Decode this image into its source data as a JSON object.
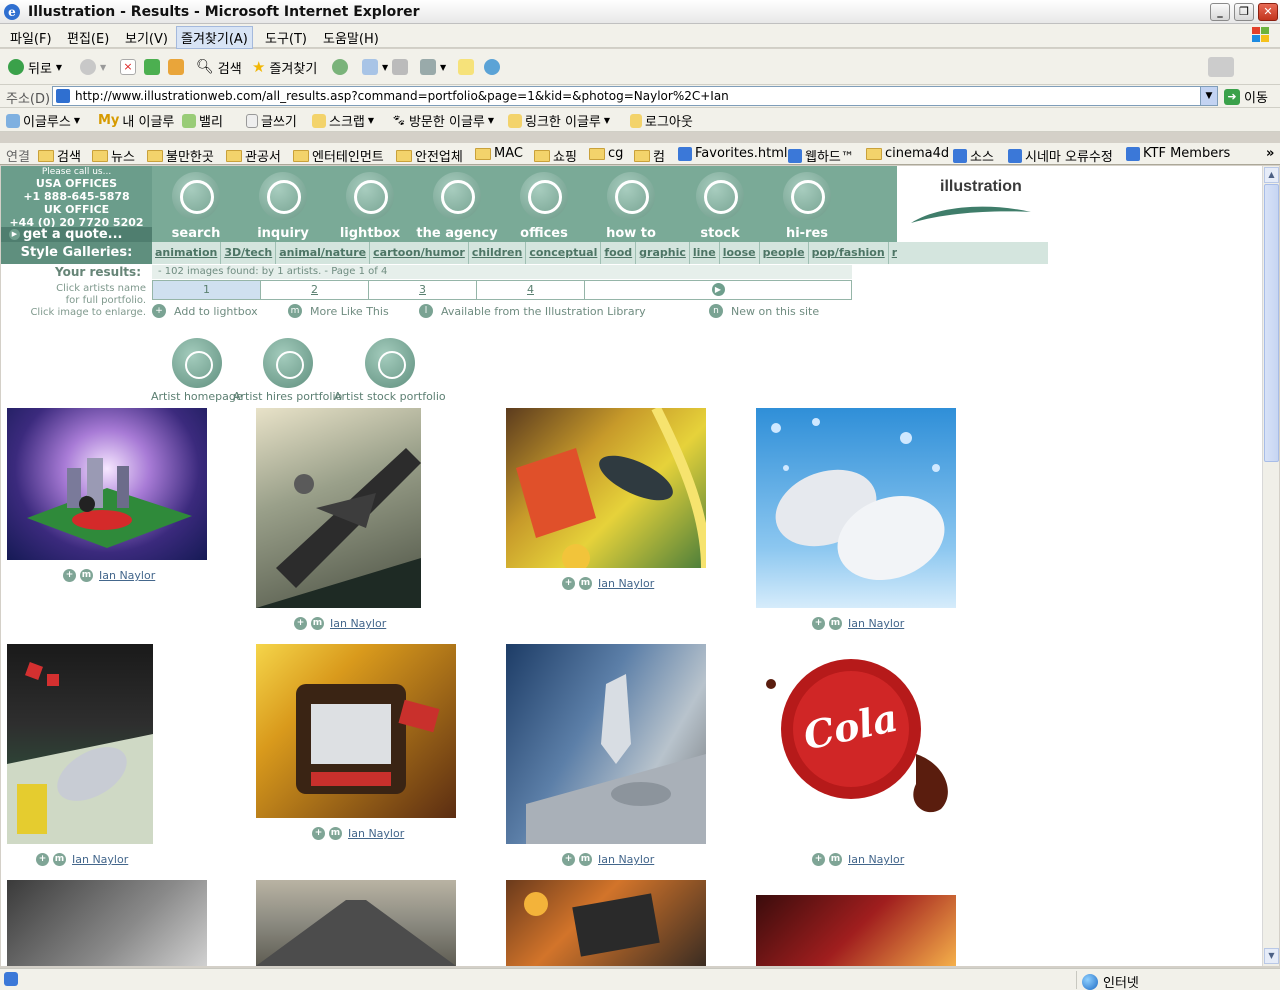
{
  "window": {
    "title": "Illustration - Results - Microsoft Internet Explorer"
  },
  "menu": [
    "파일(F)",
    "편집(E)",
    "보기(V)",
    "즐겨찾기(A)",
    "도구(T)",
    "도움말(H)"
  ],
  "toolbar": {
    "back": "뒤로",
    "search": "검색",
    "favorites": "즐겨찾기"
  },
  "address": {
    "label": "주소(D)",
    "url": "http://www.illustrationweb.com/all_results.asp?command=portfolio&page=1&kid=&photog=Naylor%2C+Ian",
    "go": "이동"
  },
  "links1": [
    "이글루스",
    "내 이글루",
    "밸리",
    "글쓰기",
    "스크랩",
    "방문한 이글루",
    "링크한 이글루",
    "로그아웃"
  ],
  "links2": {
    "label": "연결",
    "items": [
      "검색",
      "뉴스",
      "불만한곳",
      "관공서",
      "엔터테인먼트",
      "안전업체",
      "MAC",
      "쇼핑",
      "cg",
      "컴",
      "Favorites.html",
      "웹하드™",
      "cinema4d",
      "소스",
      "시네마 오류수정",
      "KTF Members"
    ]
  },
  "contact": {
    "callus": "Please call us...",
    "usa": "USA OFFICES",
    "usa_phone": "+1 888-645-5878",
    "uk": "UK OFFICE",
    "uk_phone": "+44 (0) 20 7720 5202",
    "quote": "get a quote..."
  },
  "nav": [
    "search",
    "inquiry",
    "lightbox",
    "the agency",
    "offices",
    "how to",
    "stock",
    "hi-res"
  ],
  "logo": "illustration",
  "galleries": {
    "label": "Style Galleries:",
    "items": [
      "animation",
      "3D/tech",
      "animal/nature",
      "cartoon/humor",
      "children",
      "conceptual",
      "food",
      "graphic",
      "line",
      "loose",
      "people",
      "pop/fashion",
      "realistic"
    ]
  },
  "results": {
    "label": "Your results:",
    "summary": "- 102 images found: by 1 artists. - Page 1 of 4",
    "hint1": "Click artists name",
    "hint2": "for full portfolio.",
    "hint3": "Click image to enlarge.",
    "pages": [
      "1",
      "2",
      "3",
      "4"
    ],
    "current_page": 1
  },
  "legend": [
    "Add to lightbox",
    "More Like This",
    "Available from the Illustration Library",
    "New on this site"
  ],
  "artist_buttons": [
    "Artist homepage",
    "Artist hires portfolio",
    "Artist stock portfolio"
  ],
  "artist_name": "Ian Naylor",
  "status": {
    "zone": "인터넷"
  },
  "colors": {
    "nav_green": "#7aaa97",
    "dark_green": "#5f8f7e",
    "light_green": "#d4e5de",
    "link_blue": "#44678c"
  }
}
